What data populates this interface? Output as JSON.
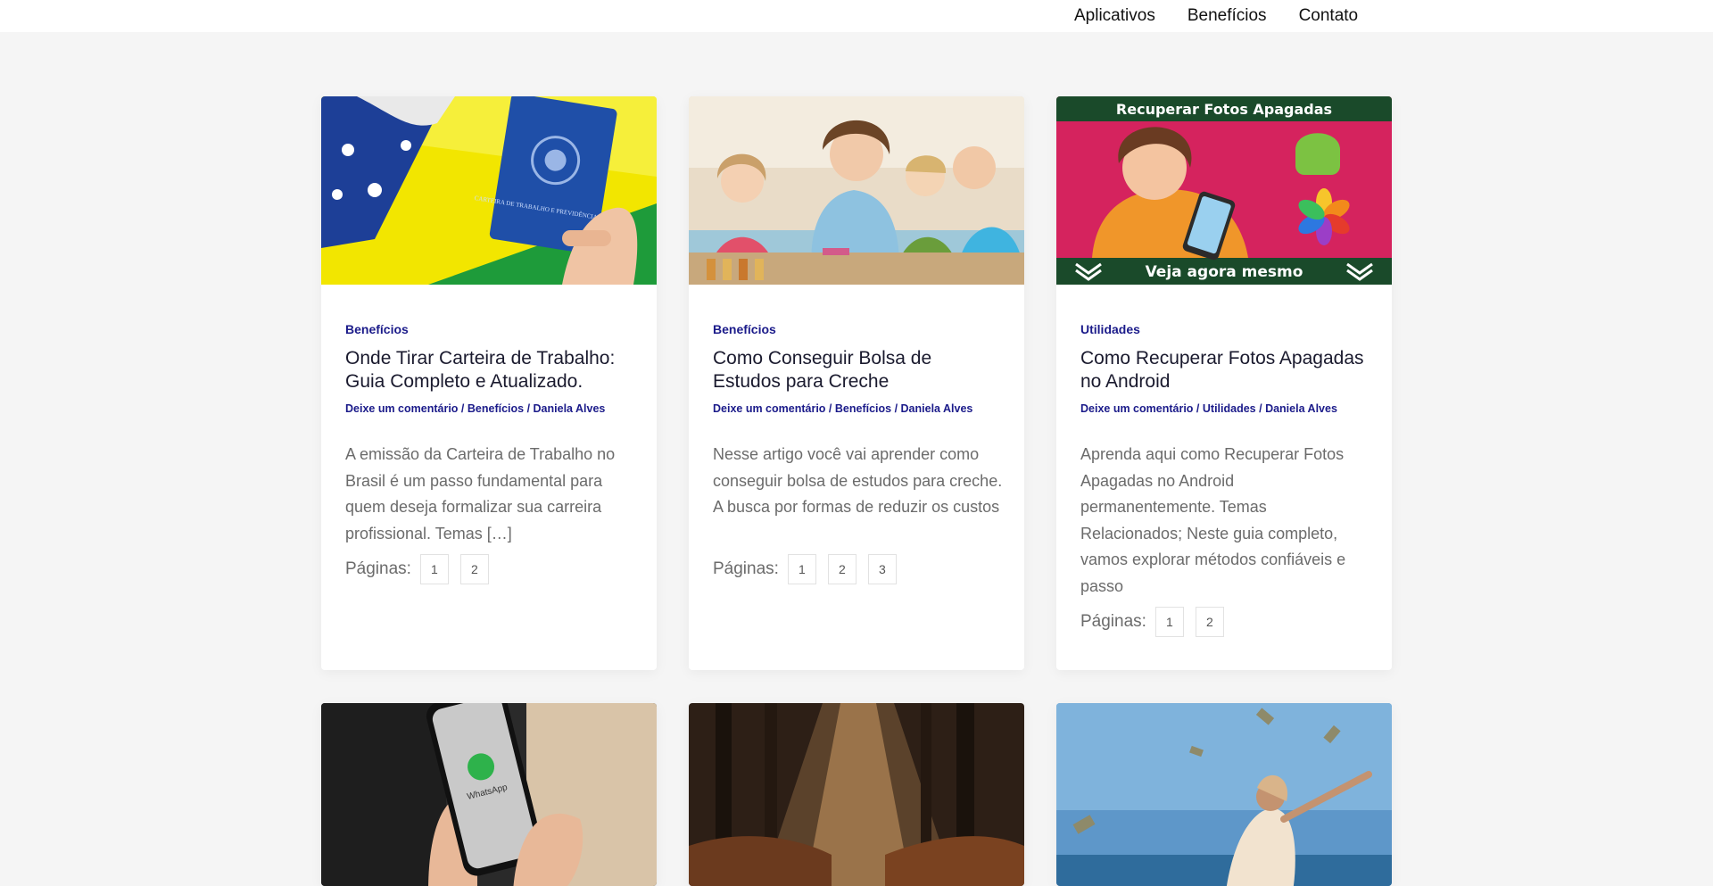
{
  "nav": {
    "items": [
      "Aplicativos",
      "Benefícios",
      "Contato"
    ]
  },
  "colors": {
    "accent": "#1b1b8a",
    "excerpt": "#6b6b6b",
    "background": "#f5f5f5"
  },
  "pages_label": "Páginas:",
  "cards": [
    {
      "category": "Benefícios",
      "title": "Onde Tirar Carteira de Trabalho: Guia Completo e Atualizado.",
      "meta": {
        "comment": "Deixe um comentário",
        "category": "Benefícios",
        "author": "Daniela Alves"
      },
      "excerpt": "A emissão da Carteira de Trabalho no Brasil é um passo fundamental para quem deseja formalizar sua carreira profissional. Temas […]",
      "pages": [
        "1",
        "2"
      ],
      "image": {
        "card_title_text": "CARTEIRA DE TRABALHO E PREVIDÊNCIA SOCIAL"
      }
    },
    {
      "category": "Benefícios",
      "title": "Como Conseguir Bolsa de Estudos para Creche",
      "meta": {
        "comment": "Deixe um comentário",
        "category": "Benefícios",
        "author": "Daniela Alves"
      },
      "excerpt": "Nesse artigo você vai aprender como conseguir bolsa de estudos para creche. A busca por formas de reduzir os custos",
      "pages": [
        "1",
        "2",
        "3"
      ]
    },
    {
      "category": "Utilidades",
      "title": "Como Recuperar Fotos Apagadas no Android",
      "meta": {
        "comment": "Deixe um comentário",
        "category": "Utilidades",
        "author": "Daniela Alves"
      },
      "excerpt": "Aprenda aqui como Recuperar Fotos Apagadas no Android permanentemente. Temas Relacionados; Neste guia completo, vamos explorar métodos confiáveis e passo",
      "pages": [
        "1",
        "2"
      ],
      "image": {
        "banner_top": "Recuperar Fotos Apagadas",
        "banner_bottom": "Veja agora mesmo"
      }
    }
  ],
  "bottom_cards": [
    {
      "image": {
        "phone_text": "WhatsApp"
      }
    },
    {
      "image": {}
    },
    {
      "image": {}
    }
  ]
}
